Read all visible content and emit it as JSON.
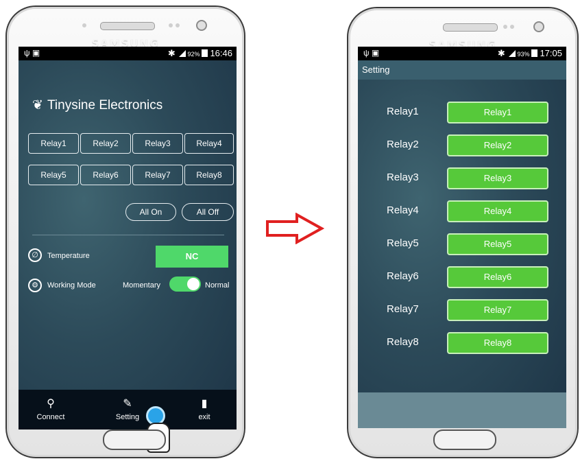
{
  "left_phone": {
    "brand": "SAMSUNG",
    "status": {
      "time": "16:46",
      "battery": "92%"
    },
    "title": "Tinysine Electronics",
    "relays_row1": [
      "Relay1",
      "Relay2",
      "Relay3",
      "Relay4"
    ],
    "relays_row2": [
      "Relay5",
      "Relay6",
      "Relay7",
      "Relay8"
    ],
    "all_on": "All On",
    "all_off": "All Off",
    "temperature_label": "Temperature",
    "temperature_value": "NC",
    "working_mode_label": "Working Mode",
    "mode_left": "Momentary",
    "mode_right": "Normal",
    "nav": {
      "connect": "Connect",
      "setting": "Setting",
      "exit": "exit"
    }
  },
  "right_phone": {
    "brand": "SAMSUNG",
    "status": {
      "time": "17:05",
      "battery": "93%"
    },
    "header": "Setting",
    "relays": [
      {
        "label": "Relay1",
        "button": "Relay1"
      },
      {
        "label": "Relay2",
        "button": "Relay2"
      },
      {
        "label": "Relay3",
        "button": "Relay3"
      },
      {
        "label": "Relay4",
        "button": "Relay4"
      },
      {
        "label": "Relay5",
        "button": "Relay5"
      },
      {
        "label": "Relay6",
        "button": "Relay6"
      },
      {
        "label": "Relay7",
        "button": "Relay7"
      },
      {
        "label": "Relay8",
        "button": "Relay8"
      }
    ]
  },
  "colors": {
    "accent_green": "#4fd86a",
    "relay_green": "#56c93a",
    "arrow_red": "#e02020"
  }
}
